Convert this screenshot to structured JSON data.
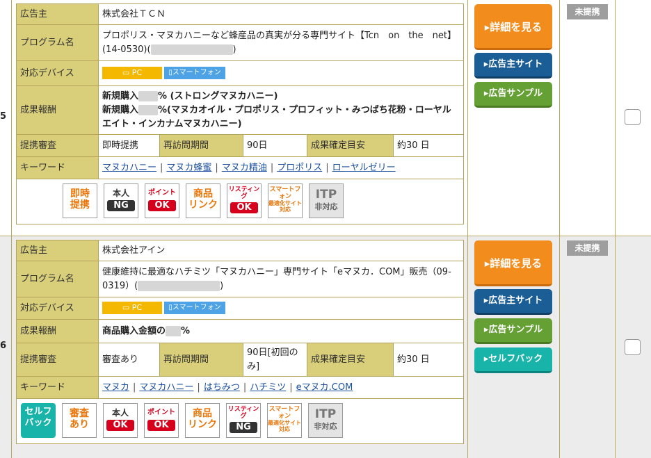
{
  "listings": [
    {
      "index": "5",
      "advertiser": "株式会社ＴＣＮ",
      "program_name": "プロポリス・マヌカハニーなど蜂産品の真実が分る専門サイト【Tcn　on　the　net】(14-0530)(",
      "program_name_end": ")",
      "device_pc": "PC",
      "device_sp": "スマートフォン",
      "reward_line1": "新規購入",
      "reward_line1_suffix": "% (ストロングマヌカハニー)",
      "reward_line2": "新規購入",
      "reward_line2_suffix": "%(マヌカオイル・プロポリス・プロフィット・みつばち花粉・ローヤルエイト・インカナムマヌカハニー)",
      "approval": "即時提携",
      "revisit_label": "再訪問期間",
      "revisit": "90日",
      "confirm_label": "成果確定目安",
      "confirm": "約30 日",
      "keywords": [
        "マヌカハニー",
        "マヌカ蜂蜜",
        "マヌカ精油",
        "プロポリス",
        "ローヤルゼリー"
      ],
      "icons": [
        {
          "top": "即時",
          "bottom": "提携",
          "color": "#e8760a",
          "style": "text"
        },
        {
          "top": "本人",
          "bottom": "NG",
          "color": "#333333",
          "style": "badge"
        },
        {
          "top": "ポイント",
          "bottom": "OK",
          "color": "#d6001c",
          "style": "badge"
        },
        {
          "top": "商品",
          "bottom": "リンク",
          "color": "#e8760a",
          "style": "text"
        },
        {
          "top": "リスティング",
          "bottom": "OK",
          "color": "#d6001c",
          "style": "badge"
        },
        {
          "top": "スマートフォン",
          "bottom": "最適化サイト対応",
          "color": "#e8760a",
          "style": "small"
        },
        {
          "top": "ITP",
          "bottom": "非対応",
          "color": "#666666",
          "style": "itp"
        }
      ],
      "buttons": [
        "詳細を見る",
        "広告主サイト",
        "広告サンプル"
      ],
      "status": "未提携"
    },
    {
      "index": "6",
      "advertiser": "株式会社アイン",
      "program_name": "健康維持に最適なハチミツ「マヌカハニー」専門サイト「eマヌカ．COM」販売（09-0319）(",
      "program_name_end": ")",
      "device_pc": "PC",
      "device_sp": "スマートフォン",
      "reward_line1": "商品購入金額の",
      "reward_line1_suffix": "%",
      "approval": "審査あり",
      "revisit_label": "再訪問期間",
      "revisit": "90日[初回のみ]",
      "confirm_label": "成果確定目安",
      "confirm": "約30 日",
      "keywords": [
        "マヌカ",
        "マヌカハニー",
        "はちみつ",
        "ハチミツ",
        "eマヌカ.COM"
      ],
      "icons": [
        {
          "top": "セルフ",
          "bottom": "バック",
          "color": "#18b3a9",
          "style": "self"
        },
        {
          "top": "審査",
          "bottom": "あり",
          "color": "#e8760a",
          "style": "text"
        },
        {
          "top": "本人",
          "bottom": "OK",
          "color": "#d6001c",
          "style": "badge"
        },
        {
          "top": "ポイント",
          "bottom": "OK",
          "color": "#d6001c",
          "style": "badge"
        },
        {
          "top": "商品",
          "bottom": "リンク",
          "color": "#e8760a",
          "style": "text"
        },
        {
          "top": "リスティング",
          "bottom": "NG",
          "color": "#333333",
          "style": "badge"
        },
        {
          "top": "スマートフォン",
          "bottom": "最適化サイト対応",
          "color": "#e8760a",
          "style": "small"
        },
        {
          "top": "ITP",
          "bottom": "非対応",
          "color": "#666666",
          "style": "itp"
        }
      ],
      "buttons": [
        "詳細を見る",
        "広告主サイト",
        "広告サンプル",
        "セルフバック"
      ],
      "status": "未提携"
    }
  ],
  "labels": {
    "advertiser": "広告主",
    "program_name": "プログラム名",
    "device": "対応デバイス",
    "reward": "成果報酬",
    "approval": "提携審査",
    "keyword": "キーワード"
  }
}
